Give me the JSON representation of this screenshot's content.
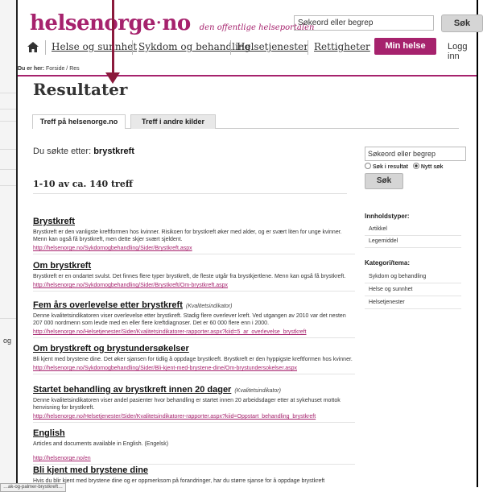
{
  "header": {
    "logo_name": "helsenorge",
    "logo_suffix": "no",
    "tagline": "den offentlige helseportalen",
    "search_placeholder": "Søkeord eller begrep",
    "search_button": "Søk",
    "min_helse": "Min helse",
    "logg_inn": "Logg inn"
  },
  "nav": {
    "items": [
      {
        "label": "Helse og sunnhet"
      },
      {
        "label": "Sykdom og behandling"
      },
      {
        "label": "Helsetjenester"
      },
      {
        "label": "Rettigheter"
      }
    ]
  },
  "breadcrumb": {
    "prefix": "Du er her:",
    "path": "Forside / Res"
  },
  "page_title": "Resultater",
  "tabs": [
    {
      "label": "Treff på helsenorge.no"
    },
    {
      "label": "Treff i andre kilder"
    }
  ],
  "search_info": {
    "prefix": "Du søkte etter:",
    "term": "brystkreft",
    "count": "1-10 av ca. 140 treff"
  },
  "results": [
    {
      "title": "Brystkreft",
      "tag": "",
      "desc": "Brystkreft er den vanligste kreftformen hos kvinner. Risikoen for brystkreft øker med alder, og er svært liten for unge kvinner. Menn kan også få brystkreft, men dette skjer svært sjeldent.",
      "url": "http://helsenorge.no/Sykdomogbehandling/Sider/Brystkreft.aspx"
    },
    {
      "title": "Om brystkreft",
      "tag": "",
      "desc": "Brystkreft er en ondartet svulst. Det finnes flere typer brystkreft, de fleste utgår fra brystkjertlene. Menn kan også få brystkreft.",
      "url": "http://helsenorge.no/Sykdomogbehandling/Sider/Brystkreft/Om-brystkreft.aspx"
    },
    {
      "title": "Fem års overlevelse etter brystkreft",
      "tag": "(Kvalitetsindikator)",
      "desc": "Denne kvalitetsindikatoren viser overlevelse etter brystkreft. Stadig flere overlever kreft. Ved utgangen av 2010 var det nesten 207 000 nordmenn som levde med en eller flere kreftdiagnoser. Det er 60 000 flere enn i 2000.",
      "url": "http://helsenorge.no/Helsetjenester/Sider/Kvalitetsindikatorer-rapporter.aspx?kiid=5_ar_overlevelse_brystkreft"
    },
    {
      "title": "Om brystkreft og brystundersøkelser",
      "tag": "",
      "desc": "Bli kjent med brystene dine. Det øker sjansen for tidlig å oppdage brystkreft. Brystkreft er den hyppigste kreftformen hos kvinner.",
      "url": "http://helsenorge.no/Sykdomogbehandling/Sider/Bli-kjent-med-brystene-dine/Om-brystundersokelser.aspx"
    },
    {
      "title": "Startet behandling av brystkreft innen 20 dager",
      "tag": "(Kvalitetsindikator)",
      "desc": "Denne kvalitetsindikatoren viser andel pasienter hvor behandling er startet innen 20 arbeidsdager etter at sykehuset mottok henvisning for brystkreft.",
      "url": "http://helsenorge.no/Helsetjenester/Sider/Kvalitetsindikatorer-rapporter.aspx?kiid=Oppstart_behandling_brystkreft"
    },
    {
      "title": "English",
      "tag": "",
      "desc": "Articles and documents available in English. (Engelsk)",
      "url": "http://helsenorge.no/en"
    },
    {
      "title": "Bli kjent med brystene dine",
      "tag": "",
      "desc": "Hvis du blir kjent med brystene dine og er oppmerksom på forandringer, har du større sjanse for å oppdage brystkreft",
      "url": ""
    }
  ],
  "sidebar": {
    "search_placeholder": "Søkeord eller begrep",
    "radio_1": "Søk i resultat",
    "radio_2": "Nytt søk",
    "search_button": "Søk",
    "content_types_heading": "Innholdstyper:",
    "content_types": [
      "Artikkel",
      "Legemiddel"
    ],
    "categories_heading": "Kategori/tema:",
    "categories": [
      "Sykdom og behandling",
      "Helse og sunnhet",
      "Helsetjenester"
    ]
  },
  "background": {
    "left_text": "og"
  },
  "status_bar": "…ak-og-palmer-brystkreft…",
  "colors": {
    "brand": "#a6226d",
    "arrow": "#8b1a3c"
  }
}
